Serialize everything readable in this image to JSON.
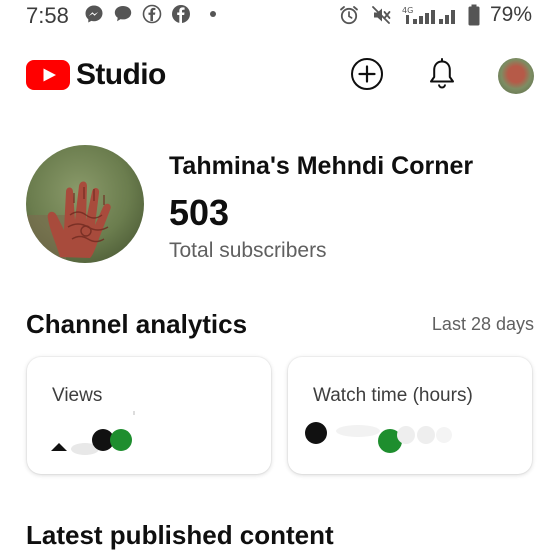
{
  "status_bar": {
    "time": "7:58",
    "network": "4G",
    "battery": "79%",
    "left_icons": [
      "messenger-icon",
      "chat-icon",
      "facebook-icon",
      "facebook-icon"
    ],
    "right_icons": [
      "alarm-icon",
      "mute-icon",
      "signal-icon",
      "battery-icon"
    ]
  },
  "app_bar": {
    "brand": "Studio",
    "logo_color": "#ff0000",
    "actions": [
      "create-icon",
      "notifications-icon",
      "account-avatar"
    ]
  },
  "channel": {
    "name": "Tahmina's Mehndi Corner",
    "subscribers": "503",
    "subscribers_label": "Total subscribers"
  },
  "analytics": {
    "title": "Channel analytics",
    "range": "Last 28 days",
    "cards": [
      {
        "label": "Views"
      },
      {
        "label": "Watch time (hours)"
      }
    ]
  },
  "latest": {
    "title": "Latest published content"
  },
  "colors": {
    "accent_green": "#1e8e2e",
    "text_secondary": "#606060"
  }
}
